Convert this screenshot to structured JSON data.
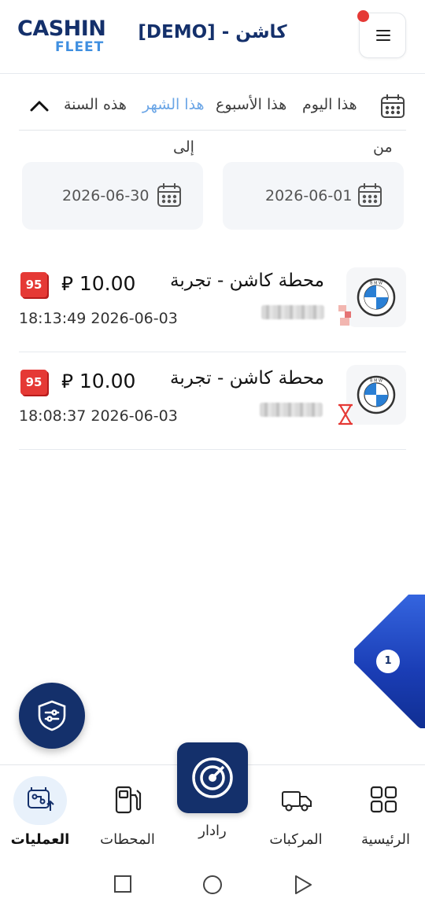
{
  "header": {
    "logo_line1": "CASHIN",
    "logo_line2": "FLEET",
    "title": "كاشن - [DEMO]"
  },
  "period_tabs": [
    {
      "label": "هذا اليوم",
      "active": false
    },
    {
      "label": "هذا الأسبوع",
      "active": false
    },
    {
      "label": "هذا الشهر",
      "active": true
    },
    {
      "label": "هذه السنة",
      "active": false
    }
  ],
  "date_range": {
    "from_label": "من",
    "from_value": "2026-06-01",
    "to_label": "إلى",
    "to_value": "2026-06-30"
  },
  "transactions": [
    {
      "station": "محطة كاشن - تجربة",
      "amount": "10.00",
      "currency": "⃁",
      "fuel": "95",
      "timestamp": "18:13:49 2026-06-03"
    },
    {
      "station": "محطة كاشن - تجربة",
      "amount": "10.00",
      "currency": "⃁",
      "fuel": "95",
      "timestamp": "18:08:37 2026-06-03"
    }
  ],
  "floating_badge": "1",
  "bottom_nav": {
    "operations": "العمليات",
    "stations": "المحطات",
    "radar": "رادار",
    "vehicles": "المركبات",
    "home": "الرئيسية"
  },
  "colors": {
    "primary": "#14306b",
    "accent": "#6aa5e6",
    "badge_red": "#e53935"
  }
}
